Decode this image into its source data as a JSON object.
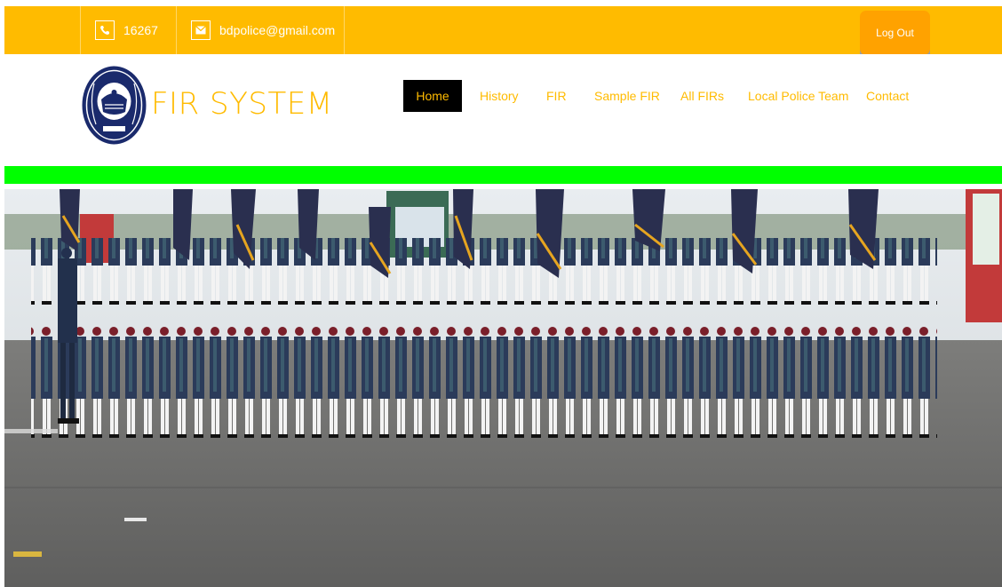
{
  "topbar": {
    "phone": "16267",
    "email": "bdpolice@gmail.com",
    "logout_label": "Log Out",
    "phone_icon": "phone-icon",
    "email_icon": "envelope-icon"
  },
  "header": {
    "brand": "FIR SYSTEM",
    "logo": "bangladesh-police-emblem"
  },
  "nav": {
    "items": [
      {
        "label": "Home",
        "active": true
      },
      {
        "label": "History"
      },
      {
        "label": "FIR"
      },
      {
        "label": "Sample FIR"
      },
      {
        "label": "All FIRs"
      },
      {
        "label": "Local Police Team"
      },
      {
        "label": "Contact"
      }
    ]
  },
  "hero": {
    "image": "police parade photo"
  },
  "colors": {
    "accent": "#ffbb00",
    "logout": "#ffa200",
    "greenbar": "#00ff00",
    "nav_active_bg": "#000000",
    "logo_navy": "#1a2a6c"
  }
}
